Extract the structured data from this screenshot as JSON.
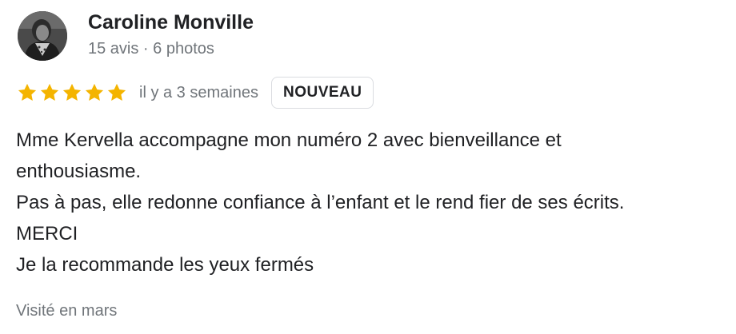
{
  "review": {
    "author": {
      "name": "Caroline Monville",
      "meta": "15 avis · 6 photos",
      "avatar_icon": "profile-photo"
    },
    "rating": {
      "stars": 5,
      "max": 5,
      "star_color": "#f4b400",
      "date": "il y a 3 semaines",
      "badge": "NOUVEAU"
    },
    "text_lines": [
      "Mme Kervella accompagne mon numéro 2 avec bienveillance et",
      "enthousiasme.",
      "Pas à pas, elle redonne confiance à l’enfant et le rend fier de ses écrits.",
      "MERCI",
      "Je la recommande les yeux fermés"
    ],
    "visited": "Visité en mars"
  }
}
